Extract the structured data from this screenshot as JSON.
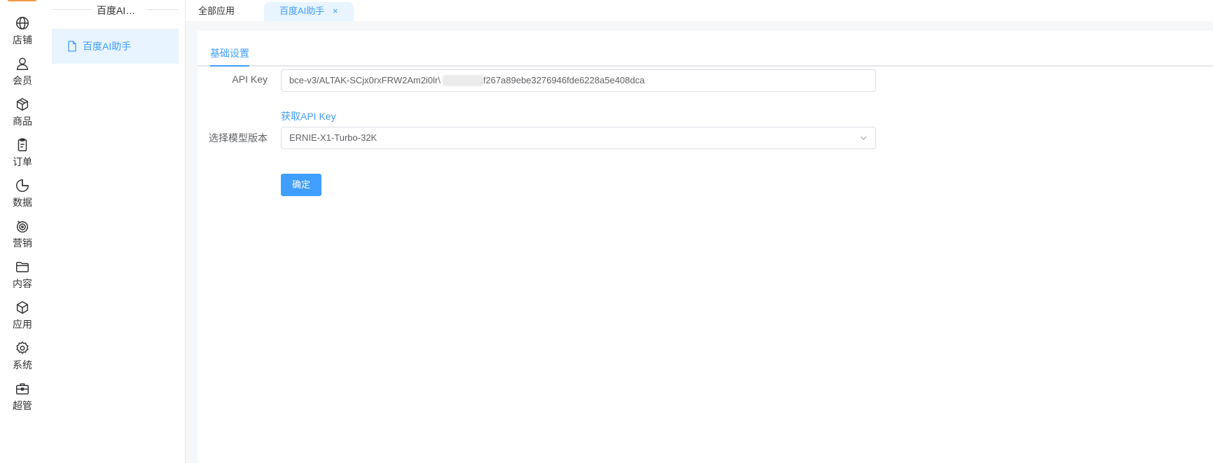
{
  "rail": {
    "items": [
      {
        "label": "店铺",
        "icon": "globe-icon"
      },
      {
        "label": "会员",
        "icon": "user-icon"
      },
      {
        "label": "商品",
        "icon": "box-icon"
      },
      {
        "label": "订单",
        "icon": "clipboard-icon"
      },
      {
        "label": "数据",
        "icon": "pie-chart-icon"
      },
      {
        "label": "营销",
        "icon": "target-icon"
      },
      {
        "label": "内容",
        "icon": "folder-icon"
      },
      {
        "label": "应用",
        "icon": "package-icon"
      },
      {
        "label": "系统",
        "icon": "gear-icon"
      },
      {
        "label": "超管",
        "icon": "briefcase-icon"
      }
    ],
    "brand_color": "#f39a46"
  },
  "submenu": {
    "title": "百度AI助手",
    "items": [
      {
        "label": "百度AI助手",
        "icon": "document-icon"
      }
    ]
  },
  "tabs": {
    "all_label": "全部应用",
    "active_label": "百度AI助手",
    "close_glyph": "×"
  },
  "panel": {
    "tab_label": "基础设置",
    "form": {
      "api_key_label": "API Key",
      "api_key_value": "bce-v3/ALTAK-SCjx0rxFRW2Am2i0lr\\",
      "api_key_value_tail": "faf267a89ebe3276946fde6228a5e408dca",
      "get_key_link": "获取API Key",
      "model_label": "选择模型版本",
      "model_value": "ERNIE-X1-Turbo-32K",
      "submit_label": "确定"
    }
  },
  "colors": {
    "accent": "#409eff",
    "accent_light": "#e8f4ff",
    "page_bg": "#f5f7f9"
  }
}
